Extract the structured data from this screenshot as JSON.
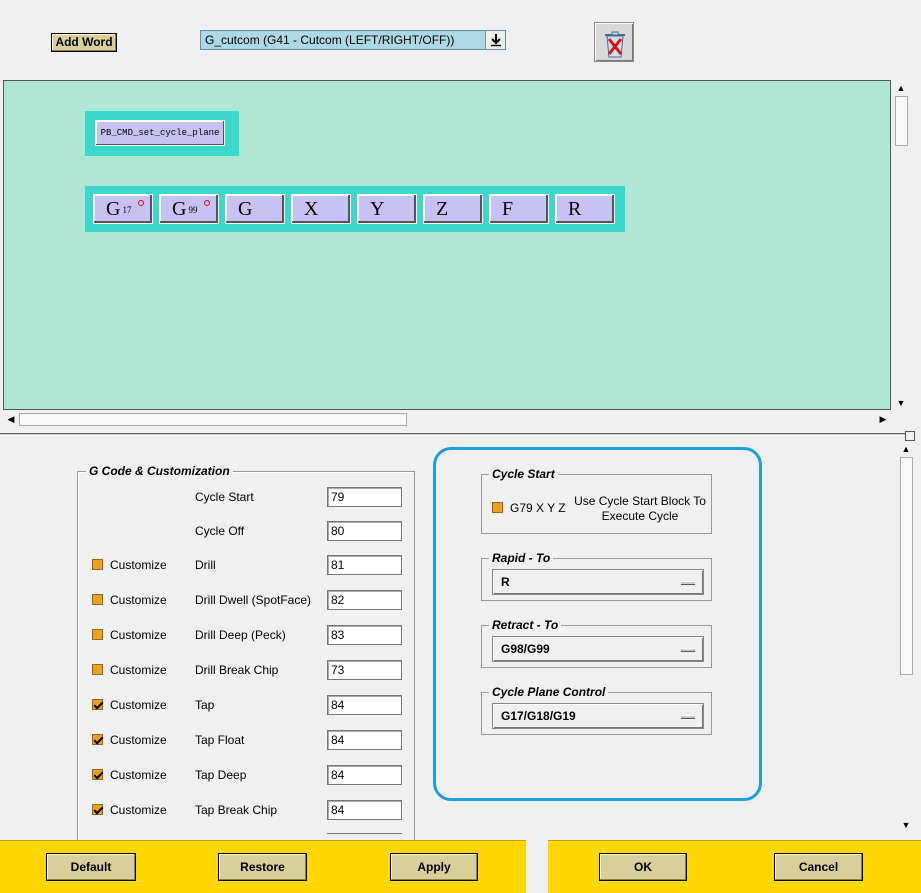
{
  "toolbar": {
    "add_word_label": "Add Word",
    "word_select_value": "G_cutcom (G41 - Cutcom (LEFT/RIGHT/OFF))",
    "trash_icon": "trash-can-icon"
  },
  "canvas": {
    "command_block": "PB_CMD_set_cycle_plane",
    "words": [
      {
        "letter": "G",
        "sub": "17",
        "flag": true
      },
      {
        "letter": "G",
        "sub": "99",
        "flag": true
      },
      {
        "letter": "G",
        "sub": "",
        "flag": false
      },
      {
        "letter": "X",
        "sub": "",
        "flag": false
      },
      {
        "letter": "Y",
        "sub": "",
        "flag": false
      },
      {
        "letter": "Z",
        "sub": "",
        "flag": false
      },
      {
        "letter": "F",
        "sub": "",
        "flag": false
      },
      {
        "letter": "R",
        "sub": "",
        "flag": false
      }
    ]
  },
  "gcode": {
    "title": "G Code & Customization",
    "customize_label": "Customize",
    "rows": [
      {
        "label": "Cycle Start",
        "value": "79",
        "has_checkbox": false,
        "checked": false
      },
      {
        "label": "Cycle Off",
        "value": "80",
        "has_checkbox": false,
        "checked": false
      },
      {
        "label": "Drill",
        "value": "81",
        "has_checkbox": true,
        "checked": false
      },
      {
        "label": "Drill Dwell (SpotFace)",
        "value": "82",
        "has_checkbox": true,
        "checked": false
      },
      {
        "label": "Drill Deep (Peck)",
        "value": "83",
        "has_checkbox": true,
        "checked": false
      },
      {
        "label": "Drill Break Chip",
        "value": "73",
        "has_checkbox": true,
        "checked": false
      },
      {
        "label": "Tap",
        "value": "84",
        "has_checkbox": true,
        "checked": true
      },
      {
        "label": "Tap Float",
        "value": "84",
        "has_checkbox": true,
        "checked": true
      },
      {
        "label": "Tap Deep",
        "value": "84",
        "has_checkbox": true,
        "checked": true
      },
      {
        "label": "Tap Break Chip",
        "value": "84",
        "has_checkbox": true,
        "checked": true
      }
    ]
  },
  "cycle": {
    "start_title": "Cycle Start",
    "start_checkbox_label": "G79 X Y Z",
    "start_description": "Use Cycle Start Block To Execute Cycle",
    "rapid_title": "Rapid - To",
    "rapid_value": "R",
    "retract_title": "Retract - To",
    "retract_value": "G98/G99",
    "plane_title": "Cycle Plane Control",
    "plane_value": "G17/G18/G19"
  },
  "footer": {
    "default": "Default",
    "restore": "Restore",
    "apply": "Apply",
    "ok": "OK",
    "cancel": "Cancel"
  },
  "colors": {
    "canvas_bg": "#aee8d4",
    "block_frame": "#3cd8cc",
    "word_bg": "#c8c2f4",
    "footer_bar": "#ffd700",
    "panel_border": "#1e9ee0",
    "checkbox": "#f0a020"
  }
}
